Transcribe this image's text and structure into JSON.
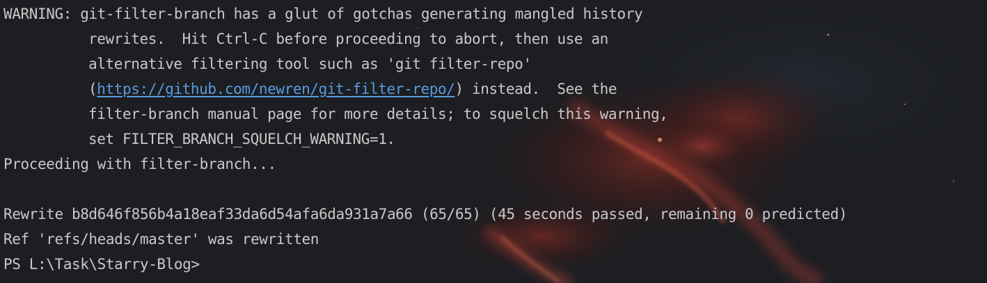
{
  "terminal": {
    "warning": {
      "line1": "WARNING: git-filter-branch has a glut of gotchas generating mangled history",
      "line2": "rewrites.  Hit Ctrl-C before proceeding to abort, then use an",
      "line3": "alternative filtering tool such as 'git filter-repo'",
      "line4_prefix": "(",
      "line4_link": "https://github.com/newren/git-filter-repo/",
      "line4_suffix": ") instead.  See the",
      "line5": "filter-branch manual page for more details; to squelch this warning,",
      "line6": "set FILTER_BRANCH_SQUELCH_WARNING=1."
    },
    "proceeding": "Proceeding with filter-branch...",
    "rewrite": "Rewrite b8d646f856b4a18eaf33da6d54afa6da931a7a66 (65/65) (45 seconds passed, remaining 0 predicted)",
    "ref_rewritten": "Ref 'refs/heads/master' was rewritten",
    "prompt": "PS L:\\Task\\Starry-Blog>"
  },
  "colors": {
    "background": "#1b1d21",
    "text": "#c9c9c9",
    "link": "#5a9be0"
  }
}
